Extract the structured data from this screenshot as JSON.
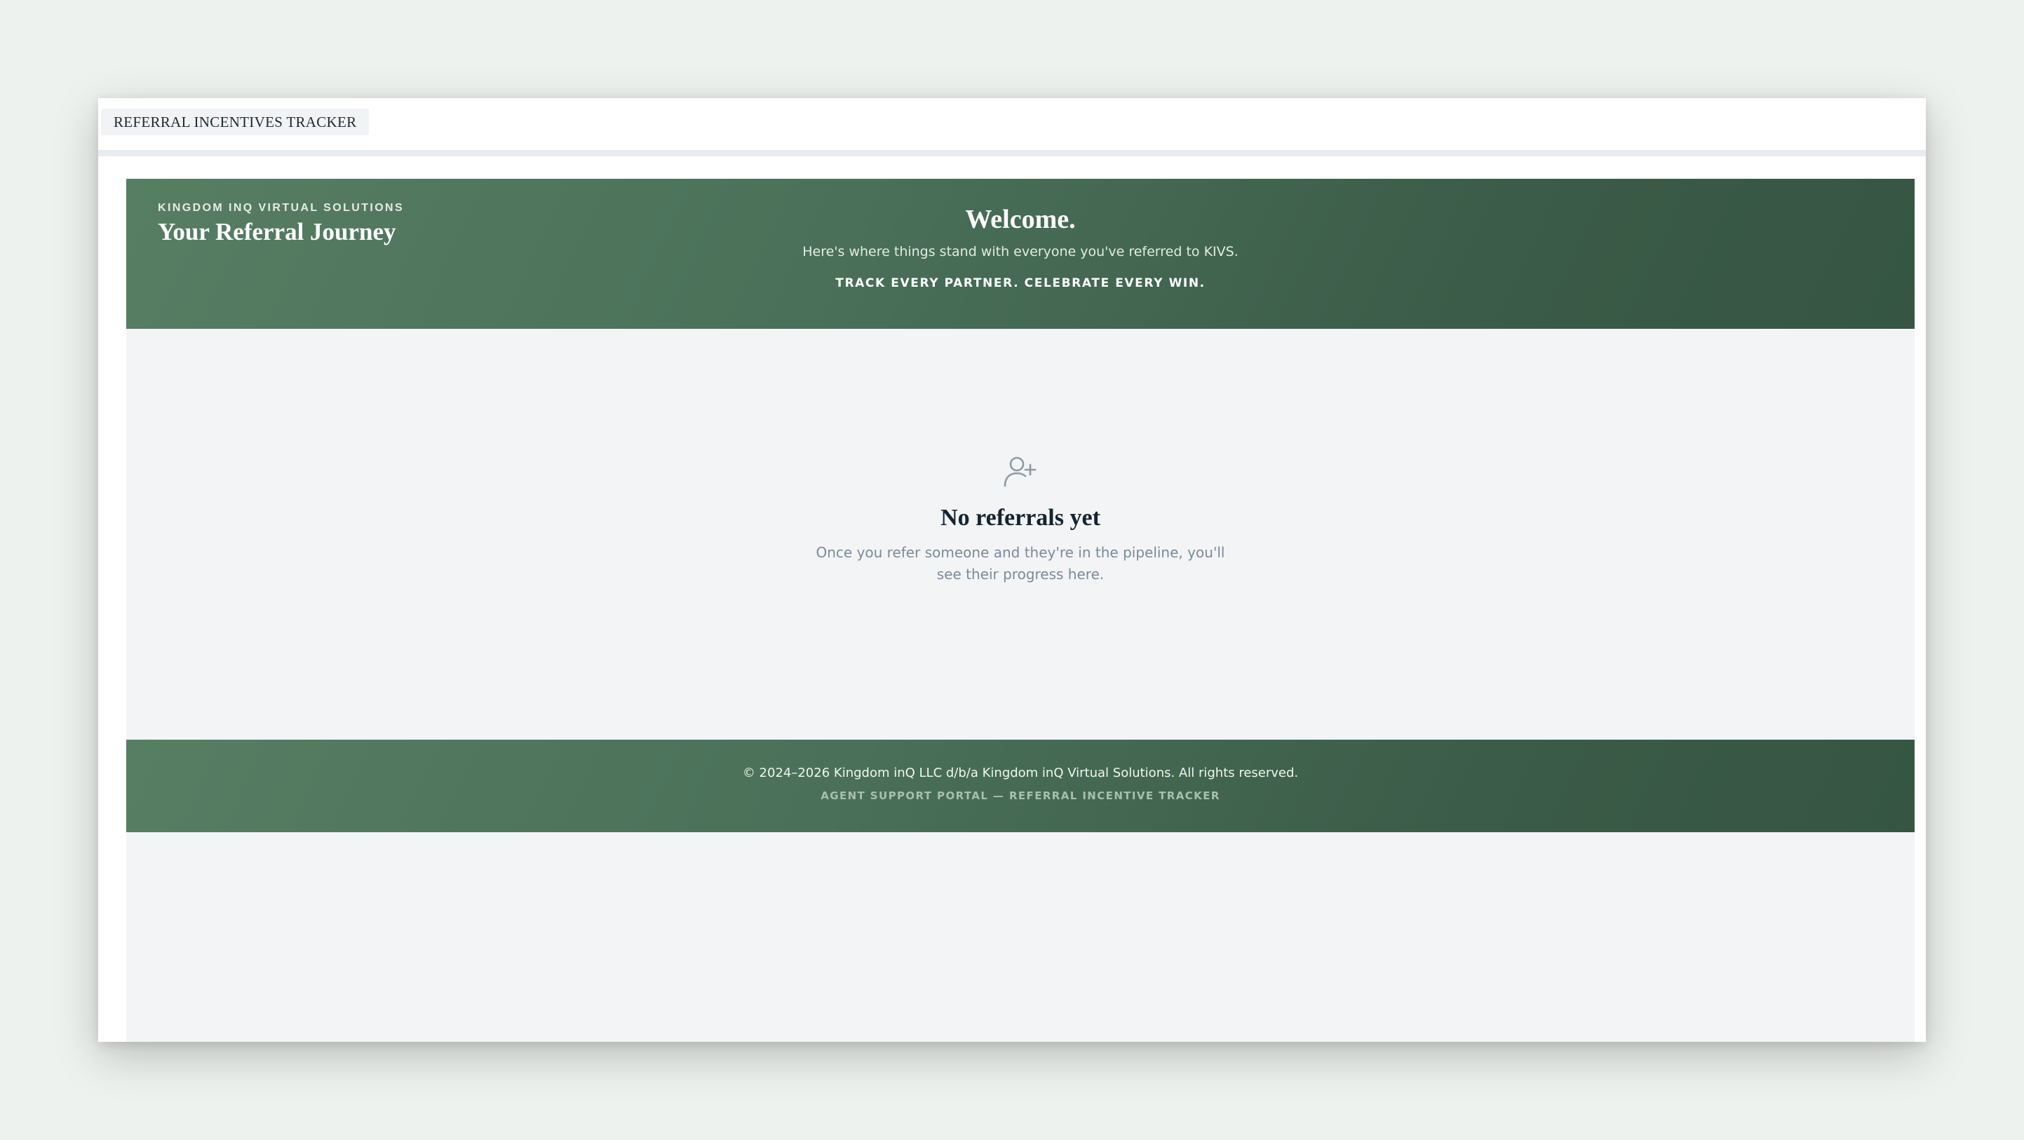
{
  "tab": {
    "label": "REFERRAL INCENTIVES TRACKER"
  },
  "header": {
    "eyebrow": "KINGDOM INQ VIRTUAL SOLUTIONS",
    "title": "Your Referral Journey",
    "welcome": "Welcome.",
    "subtitle": "Here's where things stand with everyone you've referred to KIVS.",
    "tagline": "TRACK EVERY PARTNER. CELEBRATE EVERY WIN."
  },
  "empty_state": {
    "icon": "user-plus-icon",
    "title": "No referrals yet",
    "message": "Once you refer someone and they're in the pipeline, you'll see their progress here."
  },
  "footer": {
    "copyright": "© 2024–2026 Kingdom inQ LLC d/b/a Kingdom inQ Virtual Solutions. All rights reserved.",
    "subline": "AGENT SUPPORT PORTAL — REFERRAL INCENTIVE TRACKER"
  },
  "colors": {
    "background": "#eef2ee",
    "page": "#f2f4f6",
    "brand_green": "#4a7059",
    "brand_green_dark": "#365543",
    "heading": "#142433",
    "muted_text": "#7c8a97"
  }
}
